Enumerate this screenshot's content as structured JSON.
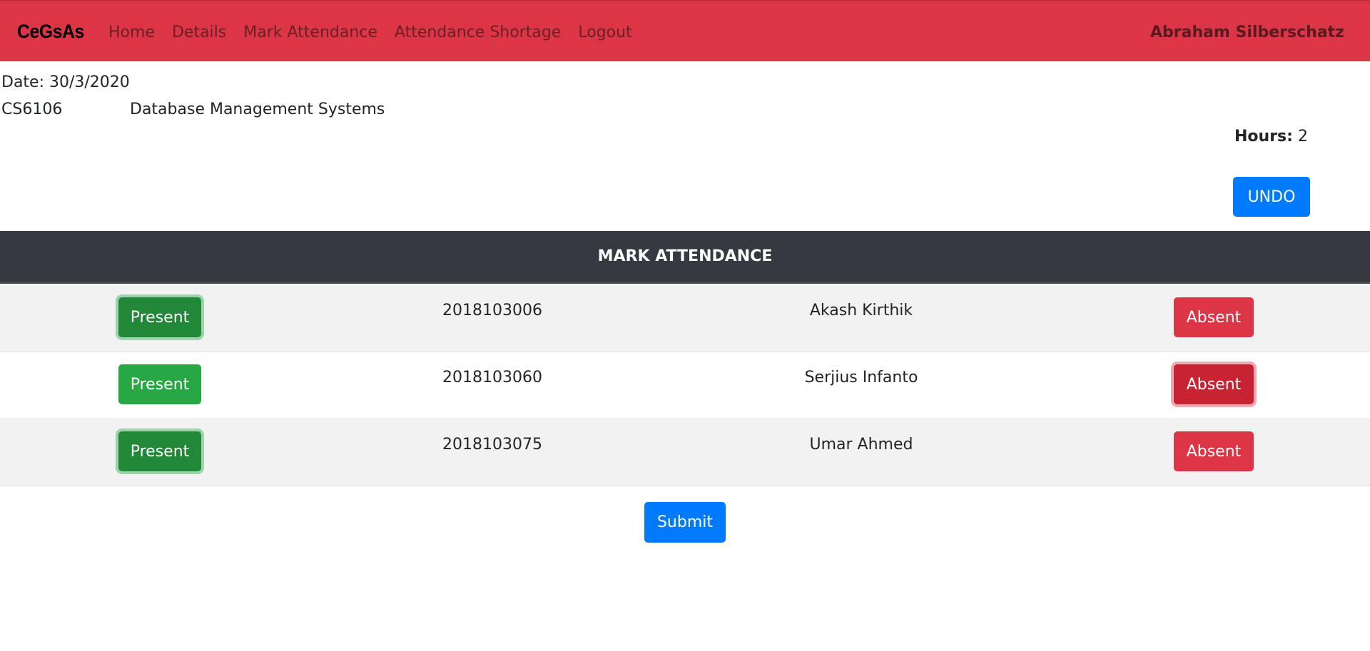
{
  "navbar": {
    "brand": "CeGsAs",
    "links": [
      "Home",
      "Details",
      "Mark Attendance",
      "Attendance Shortage",
      "Logout"
    ],
    "user": "Abraham Silberschatz",
    "bg_color": "#dc3545"
  },
  "info": {
    "date": "Date: 30/3/2020",
    "course_code": "CS6106",
    "course_name": "Database Management Systems",
    "hours_label": "Hours:",
    "hours_value": "2",
    "undo_label": "UNDO"
  },
  "table": {
    "header": "MARK ATTENDANCE",
    "rows": [
      {
        "present_label": "Present",
        "roll": "2018103006",
        "name": "Akash Kirthik",
        "absent_label": "Absent",
        "status": "present"
      },
      {
        "present_label": "Present",
        "roll": "2018103060",
        "name": "Serjius Infanto",
        "absent_label": "Absent",
        "status": "absent"
      },
      {
        "present_label": "Present",
        "roll": "2018103075",
        "name": "Umar Ahmed",
        "absent_label": "Absent",
        "status": "present"
      }
    ]
  },
  "submit_label": "Submit",
  "colors": {
    "primary": "#007bff",
    "success": "#28a745",
    "danger": "#dc3545",
    "dark": "#343a40"
  }
}
